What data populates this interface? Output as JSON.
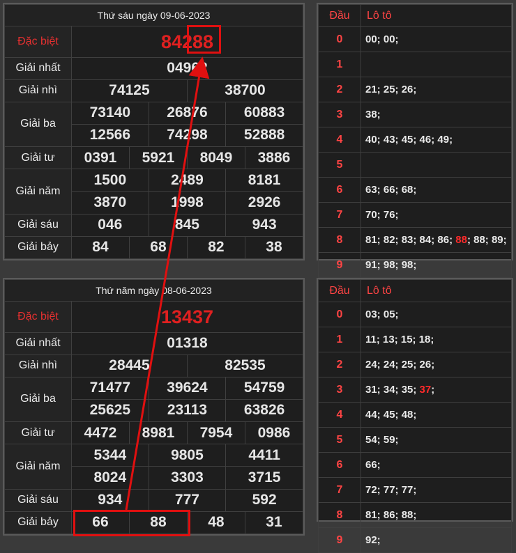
{
  "draw1": {
    "title": "Thứ sáu ngày 09-06-2023",
    "labels": [
      "Đặc biệt",
      "Giải nhất",
      "Giải nhì",
      "Giải ba",
      "Giải tư",
      "Giải năm",
      "Giải sáu",
      "Giải bảy"
    ],
    "db": "84288",
    "nhat": "04962",
    "nhi": [
      "74125",
      "38700"
    ],
    "ba": [
      "73140",
      "26876",
      "60883",
      "12566",
      "74298",
      "52888"
    ],
    "tu": [
      "0391",
      "5921",
      "8049",
      "3886"
    ],
    "nam": [
      "1500",
      "2489",
      "8181",
      "3870",
      "1998",
      "2926"
    ],
    "sau": [
      "046",
      "845",
      "943"
    ],
    "bay": [
      "84",
      "68",
      "82",
      "38"
    ]
  },
  "loto1": {
    "head_dau": "Đầu",
    "head_loto": "Lô tô",
    "rows": [
      {
        "d": "0",
        "v": "00; 00;"
      },
      {
        "d": "1",
        "v": ""
      },
      {
        "d": "2",
        "v": "21; 25; 26;"
      },
      {
        "d": "3",
        "v": "38;"
      },
      {
        "d": "4",
        "v": "40; 43; 45; 46; 49;"
      },
      {
        "d": "5",
        "v": ""
      },
      {
        "d": "6",
        "v": "63; 66; 68;"
      },
      {
        "d": "7",
        "v": "70; 76;"
      },
      {
        "d": "8",
        "v_pre": "81; 82; 83; 84; 86; ",
        "v_hl": "88",
        "v_post": "; 88; 89;"
      },
      {
        "d": "9",
        "v": "91; 98; 98;"
      }
    ]
  },
  "draw2": {
    "title": "Thứ năm ngày 08-06-2023",
    "labels": [
      "Đặc biệt",
      "Giải nhất",
      "Giải nhì",
      "Giải ba",
      "Giải tư",
      "Giải năm",
      "Giải sáu",
      "Giải bảy"
    ],
    "db": "13437",
    "nhat": "01318",
    "nhi": [
      "28445",
      "82535"
    ],
    "ba": [
      "71477",
      "39624",
      "54759",
      "25625",
      "23113",
      "63826"
    ],
    "tu": [
      "4472",
      "8981",
      "7954",
      "0986"
    ],
    "nam": [
      "5344",
      "9805",
      "4411",
      "8024",
      "3303",
      "3715"
    ],
    "sau": [
      "934",
      "777",
      "592"
    ],
    "bay": [
      "66",
      "88",
      "48",
      "31"
    ]
  },
  "loto2": {
    "head_dau": "Đầu",
    "head_loto": "Lô tô",
    "rows": [
      {
        "d": "0",
        "v": "03; 05;"
      },
      {
        "d": "1",
        "v": "11; 13; 15; 18;"
      },
      {
        "d": "2",
        "v": "24; 24; 25; 26;"
      },
      {
        "d": "3",
        "v_pre": "31; 34; 35; ",
        "v_hl": "37",
        "v_post": ";"
      },
      {
        "d": "4",
        "v": "44; 45; 48;"
      },
      {
        "d": "5",
        "v": "54; 59;"
      },
      {
        "d": "6",
        "v": "66;"
      },
      {
        "d": "7",
        "v": "72; 77; 77;"
      },
      {
        "d": "8",
        "v": "81; 86; 88;"
      },
      {
        "d": "9",
        "v": "92;"
      }
    ]
  },
  "colors": {
    "accent": "#e01010",
    "highlight": "#ff2a2a",
    "label": "#ff4444"
  }
}
